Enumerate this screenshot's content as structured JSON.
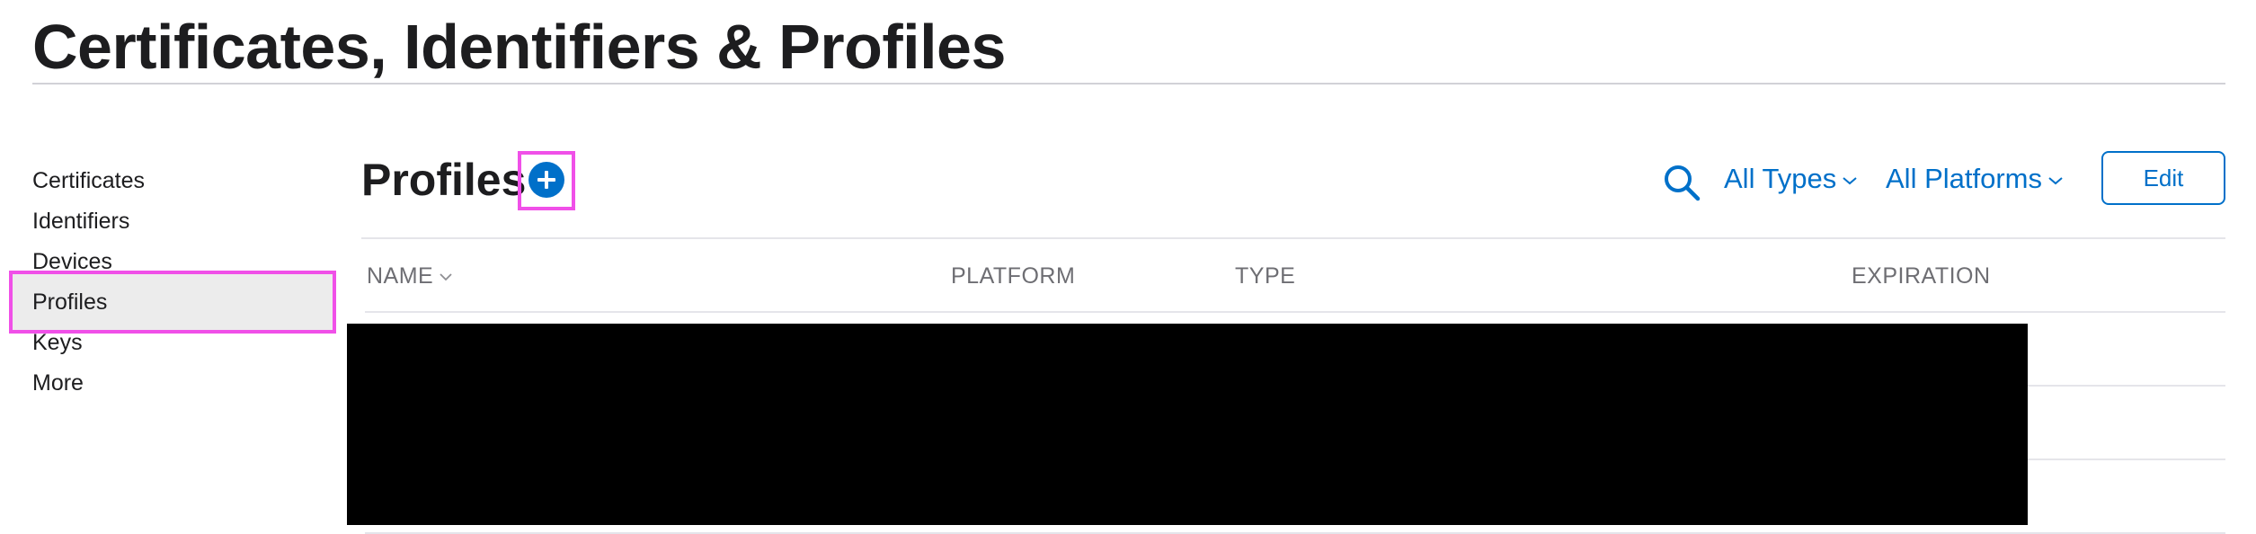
{
  "header": {
    "title": "Certificates, Identifiers & Profiles"
  },
  "sidebar": {
    "items": [
      {
        "label": "Certificates",
        "active": false
      },
      {
        "label": "Identifiers",
        "active": false
      },
      {
        "label": "Devices",
        "active": false
      },
      {
        "label": "Profiles",
        "active": true
      },
      {
        "label": "Keys",
        "active": false
      },
      {
        "label": "More",
        "active": false
      }
    ]
  },
  "main": {
    "section_title": "Profiles",
    "add_icon": "plus-circle-icon",
    "search_icon": "search-icon",
    "filters": {
      "types_label": "All Types",
      "platforms_label": "All Platforms"
    },
    "edit_label": "Edit",
    "table": {
      "columns": [
        "NAME",
        "PLATFORM",
        "TYPE",
        "EXPIRATION"
      ],
      "sorted_column": "NAME",
      "rows_redacted": true
    }
  },
  "annotations": {
    "highlight_color": "#f050e8",
    "highlighted": [
      "sidebar-item-profiles",
      "add-profile-button"
    ]
  },
  "colors": {
    "accent": "#0070c9",
    "active_item_bg": "#ececec",
    "muted_text": "#6e6e73",
    "divider": "#e5e5ea",
    "redaction": "#000000"
  }
}
